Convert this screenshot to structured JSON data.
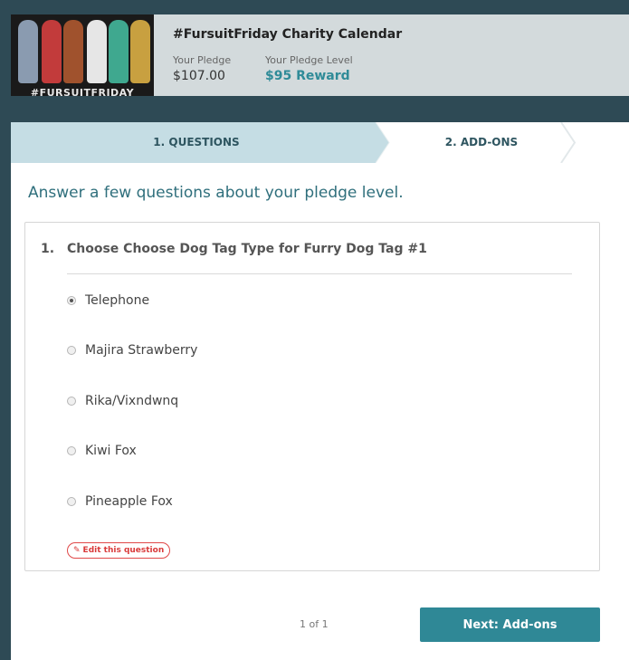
{
  "campaign": {
    "title": "#FursuitFriday Charity Calendar",
    "thumbnail_caption": "#FURSUITFRIDAY",
    "pledge_label": "Your Pledge",
    "pledge_value": "$107.00",
    "level_label": "Your Pledge Level",
    "level_value": "$95 Reward"
  },
  "steps": [
    {
      "label": "1. QUESTIONS",
      "active": true
    },
    {
      "label": "2. ADD-ONS",
      "active": false
    }
  ],
  "intro": "Answer a few questions about your pledge level.",
  "question": {
    "number": "1.",
    "text": "Choose Choose Dog Tag Type for Furry Dog Tag #1",
    "options": [
      {
        "label": "Telephone",
        "selected": true
      },
      {
        "label": "Majira Strawberry",
        "selected": false
      },
      {
        "label": "Rika/Vixndwnq",
        "selected": false
      },
      {
        "label": "Kiwi Fox",
        "selected": false
      },
      {
        "label": "Pineapple Fox",
        "selected": false
      }
    ],
    "edit_label": "Edit this question"
  },
  "footer": {
    "pager": "1 of 1",
    "next_label": "Next: Add-ons"
  },
  "colors": {
    "accent": "#2f8896",
    "step_active": "#c5dde4",
    "background": "#2e4a55"
  }
}
